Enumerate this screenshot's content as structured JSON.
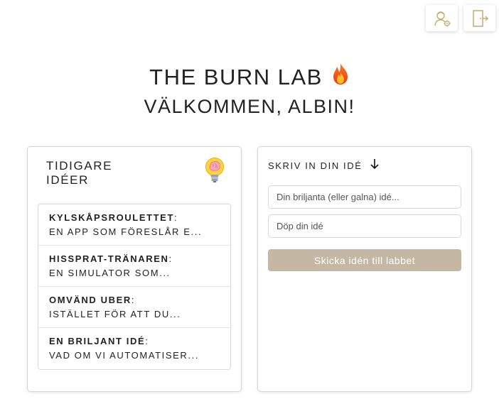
{
  "toolbar": {
    "profile_icon": "user-settings-icon",
    "logout_icon": "exit-door-icon"
  },
  "header": {
    "title": "THE BURN LAB",
    "title_icon": "fire-emoji",
    "welcome": "VÄLKOMMEN, ALBIN!"
  },
  "previous_ideas": {
    "heading_line1": "TIDIGARE",
    "heading_line2": "IDÉER",
    "heading_icon": "lightbulb-brain-emoji",
    "items": [
      {
        "title": "KYLSKÅPSROULETTET",
        "description": "EN APP SOM FÖRESLÅR E..."
      },
      {
        "title": "HISSPRAT-TRÄNAREN",
        "description": "EN SIMULATOR SOM..."
      },
      {
        "title": "OMVÄND UBER",
        "description": "ISTÄLLET FÖR ATT DU..."
      },
      {
        "title": "EN BRILJANT IDÉ",
        "description": "VAD OM VI AUTOMATISER..."
      }
    ]
  },
  "new_idea": {
    "heading": "SKRIV IN DIN IDÉ",
    "heading_icon": "arrow-down-icon",
    "idea_placeholder": "Din briljanta (eller galna) idé...",
    "idea_value": "",
    "name_placeholder": "Döp din idé",
    "name_value": "",
    "submit_label": "Skicka idén till labbet"
  },
  "colors": {
    "accent": "#c4b8a4",
    "icon_gold": "#c9a96e",
    "text": "#222222"
  }
}
